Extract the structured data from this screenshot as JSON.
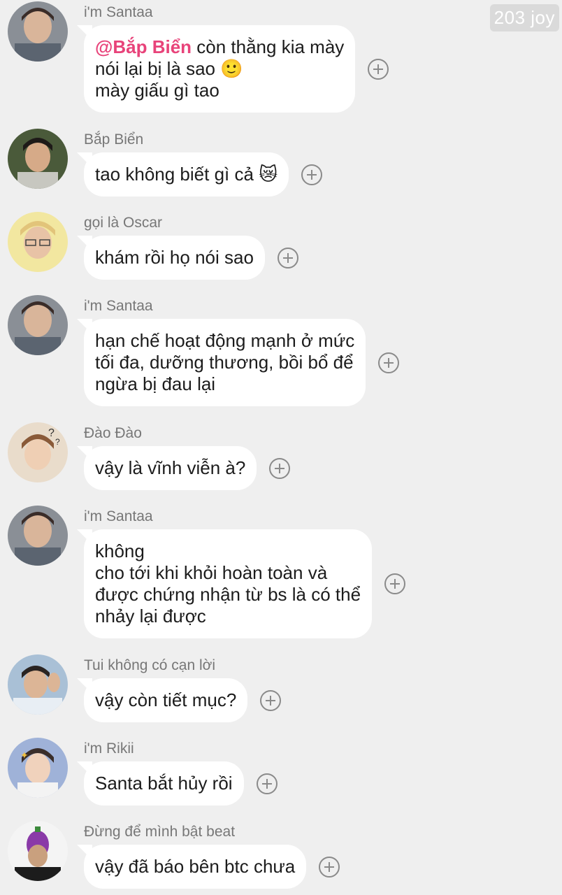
{
  "watermark": "203 joy",
  "messages": [
    {
      "sender": "i'm Santaa",
      "mention": "@Bắp Biển",
      "lines": [
        " còn thằng kia mày",
        "nói lại bị là sao 🙂",
        "mày giấu gì tao"
      ]
    },
    {
      "sender": "Bắp Biển",
      "lines": [
        "tao không biết gì cả 😿"
      ]
    },
    {
      "sender": "gọi là Oscar",
      "lines": [
        "khám rồi họ nói sao"
      ]
    },
    {
      "sender": "i'm Santaa",
      "lines": [
        "hạn chế hoạt động mạnh ở mức",
        "tối đa, dưỡng thương, bồi bổ để",
        "ngừa bị đau lại"
      ]
    },
    {
      "sender": "Đào Đào",
      "lines": [
        "vậy là vĩnh viễn à?"
      ]
    },
    {
      "sender": "i'm Santaa",
      "lines": [
        "không",
        "cho tới khi khỏi hoàn toàn và",
        "được chứng nhận từ bs là có thể",
        "nhảy lại được"
      ]
    },
    {
      "sender": "Tui không có cạn lời",
      "lines": [
        "vậy còn tiết mục?"
      ]
    },
    {
      "sender": "i'm Rikii",
      "lines": [
        "Santa bắt hủy rồi"
      ]
    },
    {
      "sender": "Đừng để mình bật beat",
      "lines": [
        "vậy đã báo bên btc chưa"
      ]
    }
  ],
  "colors": {
    "background": "#efefef",
    "bubble": "#ffffff",
    "mention": "#e8437a"
  }
}
